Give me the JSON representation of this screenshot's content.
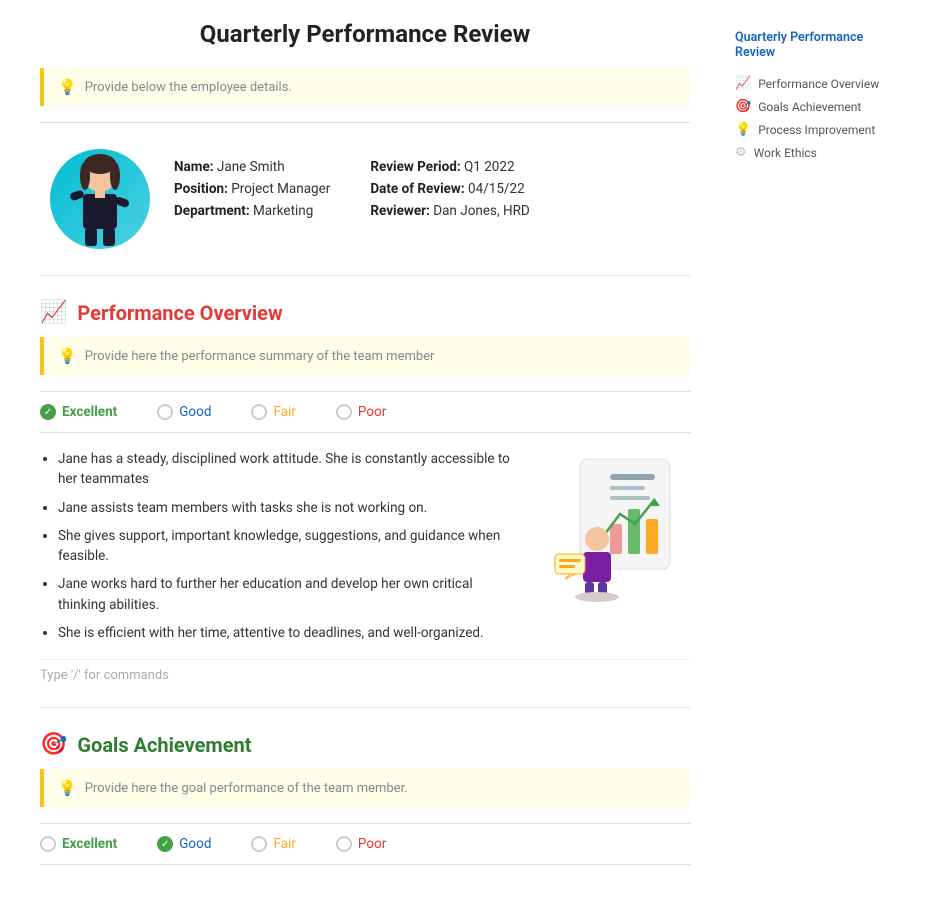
{
  "page": {
    "title": "Quarterly Performance Review"
  },
  "hint_boxes": {
    "employee_hint": "Provide below the employee details.",
    "performance_hint": "Provide here the performance summary of the team member",
    "goals_hint": "Provide here the goal performance of the team member."
  },
  "employee": {
    "name_label": "Name:",
    "name_value": "Jane Smith",
    "position_label": "Position:",
    "position_value": "Project Manager",
    "department_label": "Department:",
    "department_value": "Marketing",
    "review_period_label": "Review Period:",
    "review_period_value": "Q1 2022",
    "date_label": "Date of Review:",
    "date_value": "04/15/22",
    "reviewer_label": "Reviewer:",
    "reviewer_value": "Dan Jones, HRD"
  },
  "performance_section": {
    "icon": "📈",
    "title": "Performance Overview",
    "ratings": [
      {
        "label": "Excellent",
        "checked": true,
        "color": "excellent"
      },
      {
        "label": "Good",
        "checked": false,
        "color": "good"
      },
      {
        "label": "Fair",
        "checked": false,
        "color": "fair"
      },
      {
        "label": "Poor",
        "checked": false,
        "color": "poor"
      }
    ],
    "bullets": [
      "Jane has a steady, disciplined work attitude. She is constantly accessible to her teammates",
      "Jane assists team members with tasks she is not working on.",
      "She gives support, important knowledge, suggestions, and guidance when feasible.",
      "Jane works hard to further her education and develop her own critical thinking abilities.",
      "She is efficient with her time, attentive to deadlines, and well-organized."
    ],
    "type_hint": "Type '/' for commands"
  },
  "goals_section": {
    "icon": "🎯",
    "title": "Goals Achievement",
    "hint": "Provide here the goal performance of the team member."
  },
  "sidebar": {
    "title": "Quarterly Performance Review",
    "items": [
      {
        "label": "Performance Overview",
        "dot_color": "pink",
        "symbol": "📈"
      },
      {
        "label": "Goals Achievement",
        "dot_color": "red",
        "symbol": "🎯"
      },
      {
        "label": "Process Improvement",
        "dot_color": "yellow",
        "symbol": "💡"
      },
      {
        "label": "Work Ethics",
        "dot_color": "gray",
        "symbol": "⚙"
      }
    ]
  }
}
